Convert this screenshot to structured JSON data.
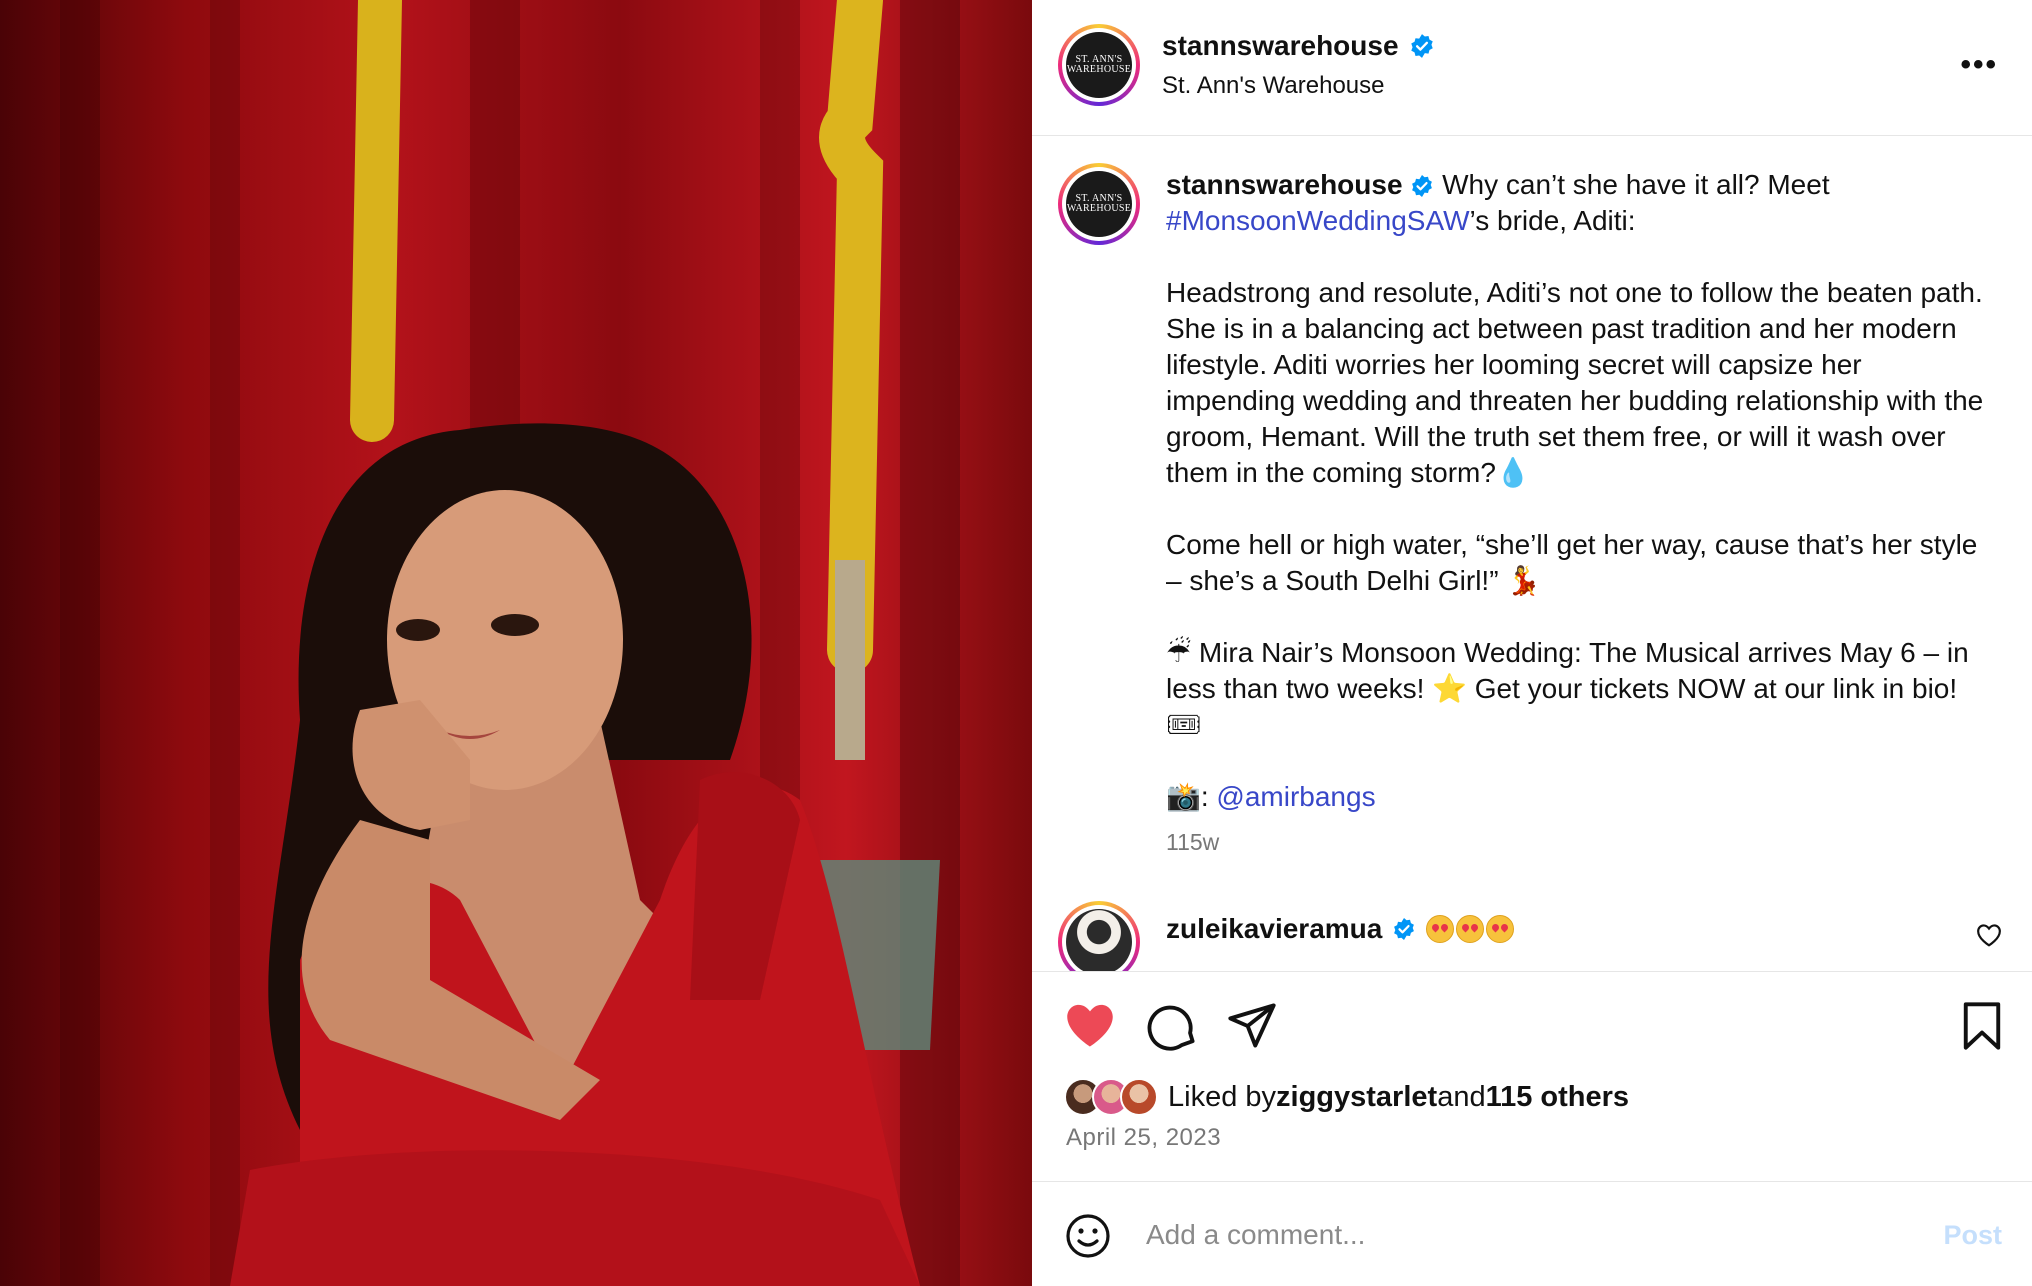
{
  "photo": {
    "alt": "",
    "icon": "post-photo"
  },
  "header": {
    "username": "stannswarehouse",
    "subtitle": "St. Ann's Warehouse",
    "avatar_text_line1": "ST. ANN'S",
    "avatar_text_line2": "WAREHOUSE",
    "more_label": "•••"
  },
  "caption": {
    "username": "stannswarehouse",
    "line1": "Why can’t she have it all? Meet",
    "hashtag": "#MonsoonWeddingSAW",
    "line1_tail": "’s bride, Aditi:",
    "para2": "Headstrong and resolute, Aditi’s not one to follow the beaten path. She is in a balancing act between past tradition and her modern lifestyle. Aditi worries her looming secret will capsize her impending wedding and threaten her budding relationship with the groom, Hemant. Will the truth set them free, or will it wash over them in the coming storm?💧",
    "para3": "Come hell or high water, “she’ll get her way, cause that’s her style – she’s a South Delhi Girl!” 💃",
    "para4": "☔ Mira Nair’s Monsoon Wedding: The Musical arrives May 6 – in less than two weeks! ⭐ Get your tickets NOW at our link in bio! 🎟",
    "photo_prefix": "📸: ",
    "photo_credit": "@amirbangs",
    "age": "115w"
  },
  "comment_preview": {
    "username": "zuleikavieramua",
    "emoji_count": 3
  },
  "actions": {
    "liked_prefix": "Liked by ",
    "liked_user": "ziggystarlet",
    "liked_and": " and ",
    "liked_others": "115 others",
    "date": "April 25, 2023",
    "colors": {
      "heart": "#ed4956",
      "link": "#3847c8",
      "verified": "#0095f6"
    }
  },
  "comment_box": {
    "placeholder": "Add a comment...",
    "post_label": "Post"
  }
}
